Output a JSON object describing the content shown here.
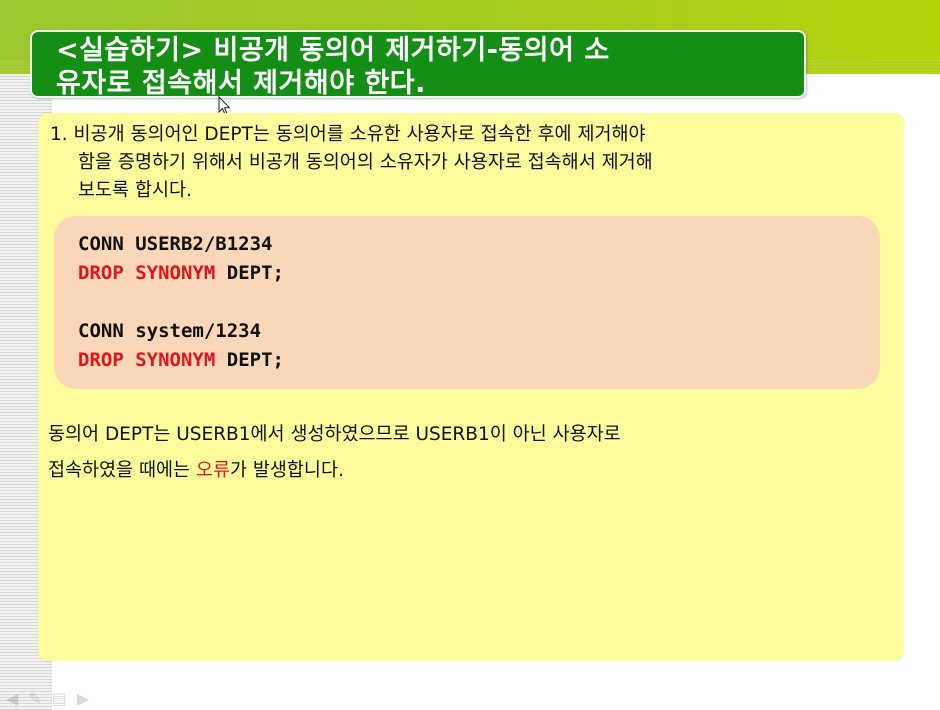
{
  "slide": {
    "title_line1": "<실습하기> 비공개 동의어 제거하기-동의어 소",
    "title_line2": "유자로 접속해서 제거해야 한다.",
    "intro_line1": "1. 비공개 동의어인 DEPT는 동의어를 소유한 사용자로 접속한 후에 제거해야",
    "intro_line2": "함을 증명하기 위해서 비공개 동의어의 소유자가 사용자로 접속해서 제거해",
    "intro_line3": "보도록 합시다.",
    "code": {
      "line1": "CONN USERB2/B1234",
      "line2_kw1": "DROP",
      "line2_kw2": "SYNONYM",
      "line2_rest": "DEPT;",
      "line4": "CONN system/1234",
      "line5_kw1": "DROP",
      "line5_kw2": "SYNONYM",
      "line5_rest": "DEPT;"
    },
    "note_line1": "동의어 DEPT는 USERB1에서 생성하였으므로 USERB1이 아닌 사용자로",
    "note_line2_a": "접속하였을 때에는 ",
    "note_line2_err": "오류",
    "note_line2_b": "가 발생합니다."
  },
  "colors": {
    "title_bg": "#148e14",
    "content_bg": "#fcfc9c",
    "code_bg": "#fad7b8",
    "keyword": "#e3141a",
    "header_band": "#a6cc1e"
  },
  "icons": [
    "mouse-cursor-icon",
    "prev-slide-icon",
    "pen-icon",
    "menu-icon",
    "next-slide-icon"
  ]
}
